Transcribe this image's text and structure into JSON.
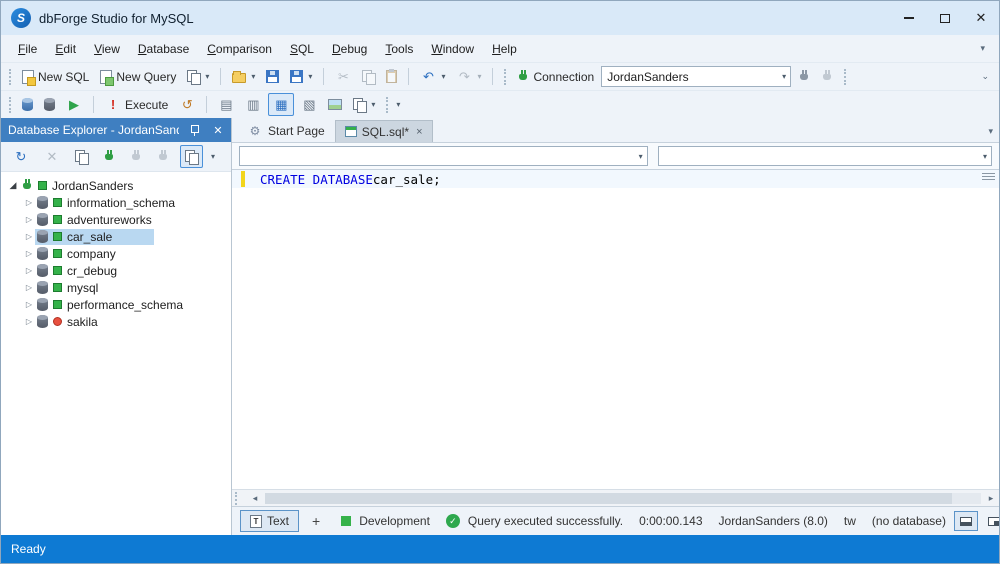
{
  "window": {
    "title": "dbForge Studio for MySQL",
    "status": "Ready"
  },
  "menu": {
    "items": [
      "File",
      "Edit",
      "View",
      "Database",
      "Comparison",
      "SQL",
      "Debug",
      "Tools",
      "Window",
      "Help"
    ]
  },
  "toolbar_standard": {
    "new_sql": "New SQL",
    "new_query": "New Query",
    "connection_label": "Connection",
    "connection_value": "JordanSanders"
  },
  "toolbar_sql": {
    "execute": "Execute"
  },
  "explorer": {
    "title": "Database Explorer - JordanSanders",
    "tree": [
      {
        "label": "JordanSanders",
        "icon": "connection",
        "status": "green",
        "expanded": true,
        "selected": false
      },
      {
        "label": "information_schema",
        "icon": "database",
        "status": "green",
        "selected": false
      },
      {
        "label": "adventureworks",
        "icon": "database",
        "status": "green",
        "selected": false
      },
      {
        "label": "car_sale",
        "icon": "database",
        "status": "green",
        "selected": true
      },
      {
        "label": "company",
        "icon": "database",
        "status": "green",
        "selected": false
      },
      {
        "label": "cr_debug",
        "icon": "database",
        "status": "green",
        "selected": false
      },
      {
        "label": "mysql",
        "icon": "database",
        "status": "green",
        "selected": false
      },
      {
        "label": "performance_schema",
        "icon": "database",
        "status": "green",
        "selected": false
      },
      {
        "label": "sakila",
        "icon": "database",
        "status": "red",
        "selected": false
      }
    ]
  },
  "doc_tabs": {
    "start_page": "Start Page",
    "sql_doc": "SQL.sql*"
  },
  "combos": {
    "left_value": "",
    "right_value": ""
  },
  "editor": {
    "line1_keyword": "CREATE DATABASE",
    "line1_rest": " car_sale;"
  },
  "bottom_bar": {
    "text_tab": "Text",
    "add_tab": "+",
    "environment": "Development",
    "status_message": "Query executed successfully.",
    "duration": "0:00:00.143",
    "connection": "JordanSanders (8.0)",
    "shortcut_mode": "tw",
    "database": "(no database)"
  },
  "icons": {
    "close": "✕",
    "tab_close": "×",
    "chevron_down": "▾",
    "overflow": "⌄",
    "expanded": "◢",
    "collapsed": "▷",
    "refresh": "↻",
    "clear": "✕",
    "cut": "✂",
    "undo": "↶",
    "redo": "↷",
    "play": "▶",
    "bang": "!",
    "history": "↺",
    "grid_a": "▤",
    "grid_b": "▥",
    "grid_active": "▦",
    "grid_c": "▧",
    "scroll_left": "◂",
    "scroll_right": "▸",
    "check": "✓",
    "gear": "⚙",
    "text_doc": "T"
  }
}
